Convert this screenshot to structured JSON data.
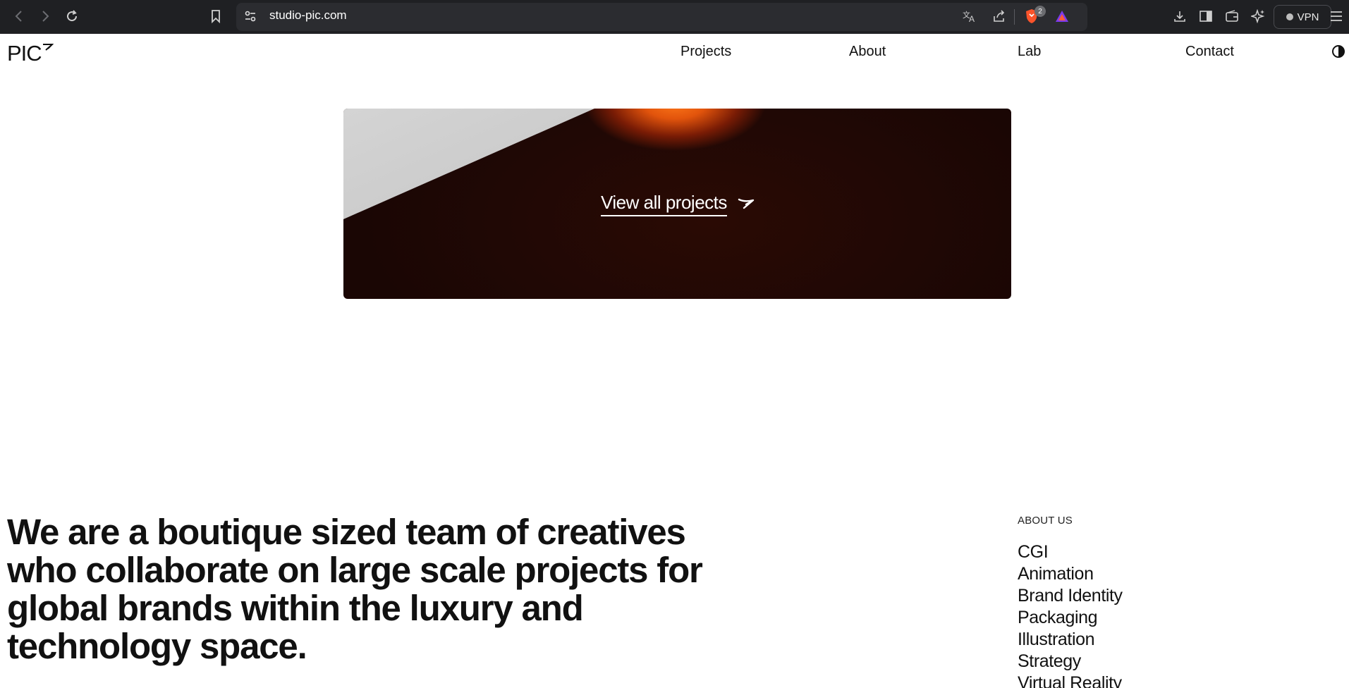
{
  "browser": {
    "url": "studio-pic.com",
    "shields_count": "2",
    "vpn_label": "VPN",
    "icons": [
      "back-icon",
      "forward-icon",
      "reload-icon",
      "bookmark-icon",
      "site-settings-icon",
      "translate-icon",
      "share-icon",
      "brave-shields-icon",
      "brave-rewards-icon",
      "downloads-icon",
      "sidebar-icon",
      "wallet-icon",
      "leo-ai-icon",
      "menu-icon"
    ]
  },
  "header": {
    "logo": "PIC",
    "nav": [
      "Projects",
      "About",
      "Lab",
      "Contact"
    ],
    "theme_toggle_icon": "contrast-icon"
  },
  "hero": {
    "link_label": "View all projects",
    "arrow_icon": "arrow-right-icon"
  },
  "about": {
    "intro": "We are a boutique sized team of creatives who collaborate on large scale projects for global brands within the luxury and technology space.",
    "label": "ABOUT US",
    "services": [
      "CGI",
      "Animation",
      "Brand Identity",
      "Packaging",
      "Illustration",
      "Strategy",
      "Virtual Reality"
    ]
  },
  "colors": {
    "chrome_bg": "#1f2023",
    "urlbar_bg": "#2b2c30",
    "page_bg": "#ffffff",
    "text": "#111111",
    "hero_dark": "#1c0604",
    "hero_glow": "#ff7a1a"
  }
}
